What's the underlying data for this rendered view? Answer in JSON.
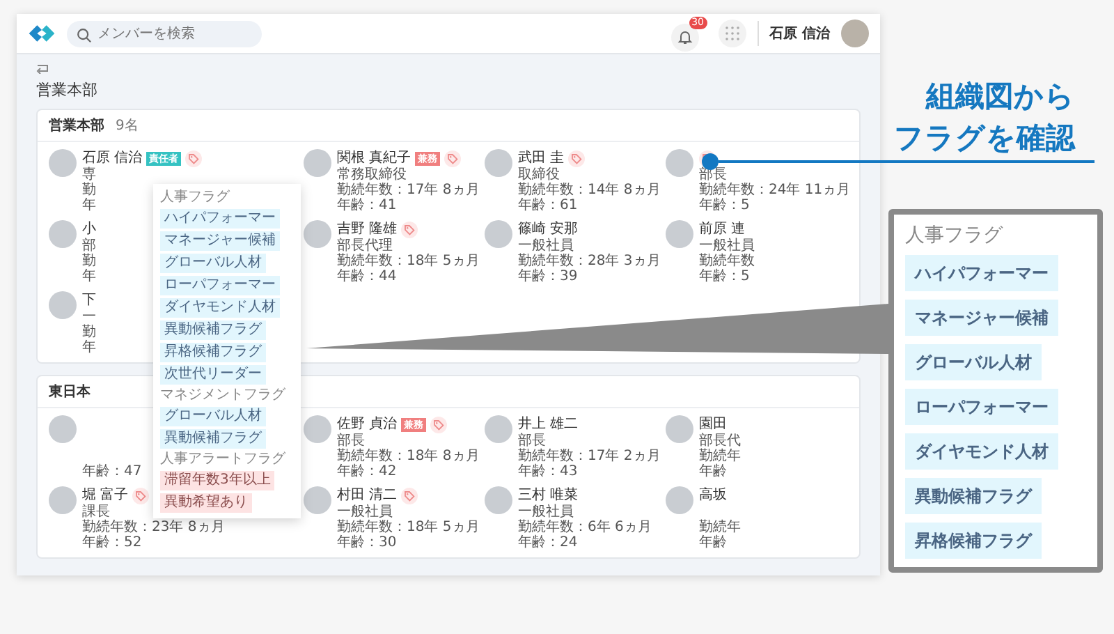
{
  "header": {
    "search": {
      "placeholder": "メンバーを検索"
    },
    "notifications": {
      "count": "30"
    },
    "user": {
      "name": "石原 信治"
    }
  },
  "page_title": "営業本部",
  "departments": [
    {
      "name": "営業本部",
      "count": "9名",
      "members": [
        {
          "name": "石原 信治",
          "badge": {
            "label": "責任者",
            "kind": "leader"
          },
          "flagged": true,
          "role": "専",
          "tenure": "勤",
          "age": "年"
        },
        {
          "name": "関根 真紀子",
          "badge": {
            "label": "兼務",
            "kind": "concurrent"
          },
          "flagged": true,
          "role": "常務取締役",
          "tenure": "勤続年数：17年 8ヵ月",
          "age": "年齢：41"
        },
        {
          "name": "武田 圭",
          "flagged": true,
          "role": "取締役",
          "tenure": "勤続年数：14年 8ヵ月",
          "age": "年齢：61"
        },
        {
          "flagged": true,
          "role": "部長",
          "tenure": "勤続年数：24年 11ヵ月",
          "age": "年齢：5"
        },
        {
          "name": "小",
          "flagged": false,
          "role": "部",
          "tenure": "勤",
          "age": "年"
        },
        {
          "name": "吉野 隆雄",
          "flagged": true,
          "role": "部長代理",
          "tenure": "勤続年数：18年 5ヵ月",
          "age": "年齢：44"
        },
        {
          "name": "篠崎 安那",
          "flagged": false,
          "role": "一般社員",
          "tenure": "勤続年数：28年 3ヵ月",
          "age": "年齢：39"
        },
        {
          "name": "前原 連",
          "flagged": false,
          "role": "一般社員",
          "tenure": "勤続年数",
          "age": "年齢：5"
        },
        {
          "name": "下",
          "flagged": false,
          "role": "一",
          "tenure": "勤",
          "age": "年"
        }
      ]
    },
    {
      "name": "東日本",
      "members": [
        {
          "flagged": false,
          "age": "年齢：47"
        },
        {
          "name": "佐野 貞治",
          "badge": {
            "label": "兼務",
            "kind": "concurrent"
          },
          "flagged": true,
          "role": "部長",
          "tenure": "勤続年数：18年 8ヵ月",
          "age": "年齢：42"
        },
        {
          "name": "井上 雄二",
          "flagged": false,
          "role": "部長",
          "tenure": "勤続年数：17年 2ヵ月",
          "age": "年齢：43"
        },
        {
          "name": "園田",
          "flagged": false,
          "role": "部長代",
          "tenure": "勤続年",
          "age": "年齢"
        },
        {
          "name": "堀 富子",
          "flagged": true,
          "role": "課長",
          "tenure": "勤続年数：23年 8ヵ月",
          "age": "年齢：52"
        },
        {
          "name": "村田 清二",
          "flagged": true,
          "role": "一般社員",
          "tenure": "勤続年数：18年 5ヵ月",
          "age": "年齢：30"
        },
        {
          "name": "三村 唯菜",
          "flagged": false,
          "role": "一般社員",
          "tenure": "勤続年数：6年 6ヵ月",
          "age": "年齢：24"
        },
        {
          "name": "高坂",
          "flagged": false,
          "tenure": "勤続年",
          "age": "年齢"
        }
      ]
    }
  ],
  "flag_popover": {
    "groups": [
      {
        "title": "人事フラグ",
        "tags": [
          {
            "label": "ハイパフォーマー",
            "kind": "info"
          },
          {
            "label": "マネージャー候補",
            "kind": "info"
          },
          {
            "label": "グローバル人材",
            "kind": "info"
          },
          {
            "label": "ローパフォーマー",
            "kind": "info"
          },
          {
            "label": "ダイヤモンド人材",
            "kind": "info"
          },
          {
            "label": "異動候補フラグ",
            "kind": "info"
          },
          {
            "label": "昇格候補フラグ",
            "kind": "info"
          },
          {
            "label": "次世代リーダー",
            "kind": "info"
          }
        ]
      },
      {
        "title": "マネジメントフラグ",
        "tags": [
          {
            "label": "グローバル人材",
            "kind": "info"
          },
          {
            "label": "異動候補フラグ",
            "kind": "info"
          }
        ]
      },
      {
        "title": "人事アラートフラグ",
        "tags": [
          {
            "label": "滞留年数3年以上",
            "kind": "alert"
          },
          {
            "label": "異動希望あり",
            "kind": "alert"
          }
        ]
      }
    ]
  },
  "callout": {
    "title": "人事フラグ",
    "tags": [
      {
        "label": "ハイパフォーマー",
        "kind": "info"
      },
      {
        "label": "マネージャー候補",
        "kind": "info"
      },
      {
        "label": "グローバル人材",
        "kind": "info"
      },
      {
        "label": "ローパフォーマー",
        "kind": "info"
      },
      {
        "label": "ダイヤモンド人材",
        "kind": "info"
      },
      {
        "label": "異動候補フラグ",
        "kind": "info"
      },
      {
        "label": "昇格候補フラグ",
        "kind": "info"
      }
    ]
  },
  "headline": [
    "組織図から",
    "フラグを確認"
  ]
}
